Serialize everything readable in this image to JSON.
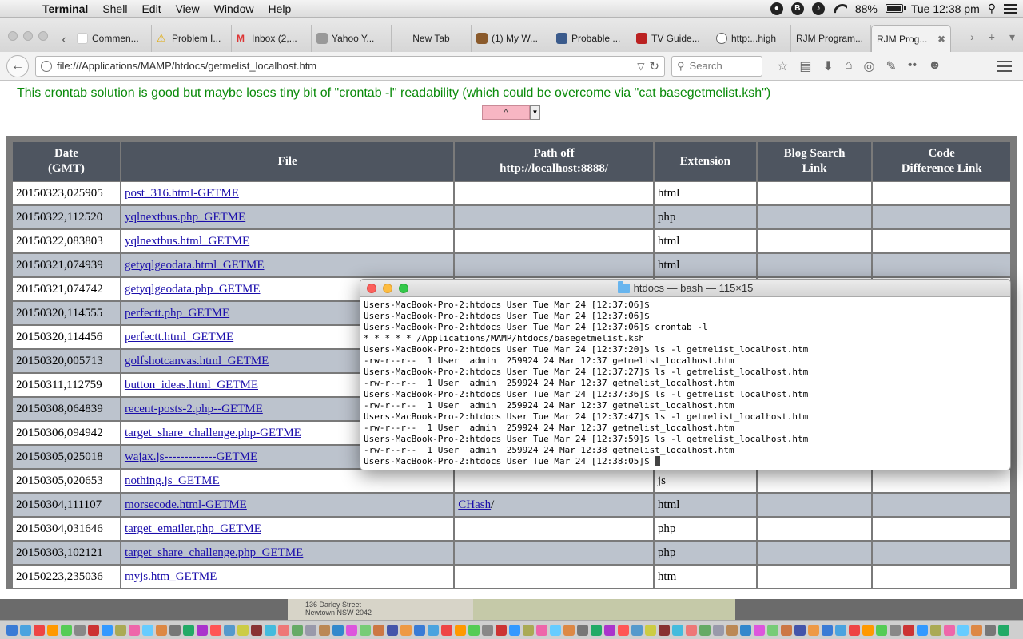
{
  "menubar": {
    "app": "Terminal",
    "items": [
      "Shell",
      "Edit",
      "View",
      "Window",
      "Help"
    ],
    "battery": "88%",
    "clock": "Tue 12:38 pm"
  },
  "browser": {
    "tabs": [
      {
        "label": "Commen..."
      },
      {
        "label": "Problem I..."
      },
      {
        "label": "Inbox (2,..."
      },
      {
        "label": "Yahoo Y..."
      },
      {
        "label": "New Tab"
      },
      {
        "label": "(1) My W..."
      },
      {
        "label": "Probable ..."
      },
      {
        "label": "TV Guide..."
      },
      {
        "label": "http:...high"
      },
      {
        "label": "RJM Program..."
      },
      {
        "label": "RJM Prog..."
      }
    ],
    "url": "file:///Applications/MAMP/htdocs/getmelist_localhost.htm",
    "search_placeholder": "Search"
  },
  "page": {
    "notice": "This crontab solution is good but maybe loses tiny bit of \"crontab -l\" readability (which could be overcome via \"cat basegetmelist.ksh\")",
    "select_value": "^",
    "table": {
      "headers": {
        "date_l1": "Date",
        "date_l2": "(GMT)",
        "file": "File",
        "path_l1": "Path off",
        "path_l2": "http://localhost:8888/",
        "ext": "Extension",
        "blog_l1": "Blog Search",
        "blog_l2": "Link",
        "code_l1": "Code",
        "code_l2": "Difference Link"
      },
      "rows": [
        {
          "date": "20150323,025905",
          "file": "post_316.html-GETME",
          "path": "",
          "ext": "html"
        },
        {
          "date": "20150322,112520",
          "file": "yqlnextbus.php_GETME",
          "path": "",
          "ext": "php"
        },
        {
          "date": "20150322,083803",
          "file": "yqlnextbus.html_GETME",
          "path": "",
          "ext": "html"
        },
        {
          "date": "20150321,074939",
          "file": "getyqlgeodata.html_GETME",
          "path": "",
          "ext": "html"
        },
        {
          "date": "20150321,074742",
          "file": "getyqlgeodata.php_GETME",
          "path": "",
          "ext": ""
        },
        {
          "date": "20150320,114555",
          "file": "perfectt.php_GETME",
          "path": "",
          "ext": ""
        },
        {
          "date": "20150320,114456",
          "file": "perfectt.html_GETME",
          "path": "",
          "ext": ""
        },
        {
          "date": "20150320,005713",
          "file": "golfshotcanvas.html_GETME",
          "path": "",
          "ext": ""
        },
        {
          "date": "20150311,112759",
          "file": "button_ideas.html_GETME",
          "path": "",
          "ext": ""
        },
        {
          "date": "20150308,064839",
          "file": "recent-posts-2.php--GETME",
          "path": "",
          "ext": ""
        },
        {
          "date": "20150306,094942",
          "file": "target_share_challenge.php-GETME",
          "path": "",
          "ext": ""
        },
        {
          "date": "20150305,025018",
          "file": "wajax.js-------------GETME",
          "path": "",
          "ext": ""
        },
        {
          "date": "20150305,020653",
          "file": "nothing.js_GETME",
          "path": "",
          "ext": "js"
        },
        {
          "date": "20150304,111107",
          "file": "morsecode.html-GETME",
          "path": "CHash",
          "ext": "html"
        },
        {
          "date": "20150304,031646",
          "file": "target_emailer.php_GETME",
          "path": "",
          "ext": "php"
        },
        {
          "date": "20150303,102121",
          "file": "target_share_challenge.php_GETME",
          "path": "",
          "ext": "php"
        },
        {
          "date": "20150223,235036",
          "file": "myjs.htm_GETME",
          "path": "",
          "ext": "htm"
        }
      ]
    }
  },
  "terminal": {
    "title": "htdocs — bash — 115×15",
    "lines": [
      "Users-MacBook-Pro-2:htdocs User Tue Mar 24 [12:37:06]$",
      "Users-MacBook-Pro-2:htdocs User Tue Mar 24 [12:37:06]$",
      "Users-MacBook-Pro-2:htdocs User Tue Mar 24 [12:37:06]$ crontab -l",
      "* * * * * /Applications/MAMP/htdocs/basegetmelist.ksh",
      "Users-MacBook-Pro-2:htdocs User Tue Mar 24 [12:37:20]$ ls -l getmelist_localhost.htm",
      "-rw-r--r--  1 User  admin  259924 24 Mar 12:37 getmelist_localhost.htm",
      "Users-MacBook-Pro-2:htdocs User Tue Mar 24 [12:37:27]$ ls -l getmelist_localhost.htm",
      "-rw-r--r--  1 User  admin  259924 24 Mar 12:37 getmelist_localhost.htm",
      "Users-MacBook-Pro-2:htdocs User Tue Mar 24 [12:37:36]$ ls -l getmelist_localhost.htm",
      "-rw-r--r--  1 User  admin  259924 24 Mar 12:37 getmelist_localhost.htm",
      "Users-MacBook-Pro-2:htdocs User Tue Mar 24 [12:37:47]$ ls -l getmelist_localhost.htm",
      "-rw-r--r--  1 User  admin  259924 24 Mar 12:37 getmelist_localhost.htm",
      "Users-MacBook-Pro-2:htdocs User Tue Mar 24 [12:37:59]$ ls -l getmelist_localhost.htm",
      "-rw-r--r--  1 User  admin  259924 24 Mar 12:38 getmelist_localhost.htm",
      "Users-MacBook-Pro-2:htdocs User Tue Mar 24 [12:38:05]$ "
    ]
  },
  "background": {
    "address_l1": "136 Darley Street",
    "address_l2": "Newtown NSW 2042"
  },
  "colors": {
    "notice": "#0a8a0a",
    "header_bg": "#4e5560",
    "row_alt": "#bcc3cd",
    "link": "#1a0dab"
  }
}
